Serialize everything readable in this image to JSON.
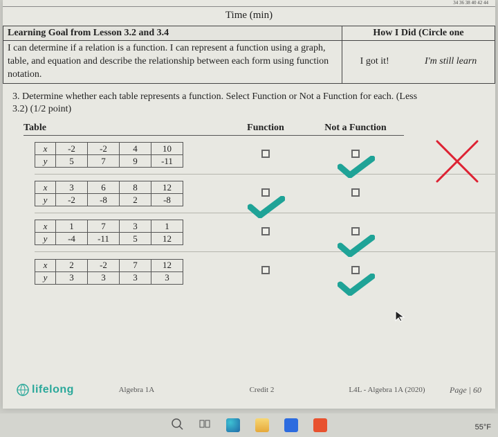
{
  "ruler_marks": "34   36   38   40   42   44",
  "time_label": "Time (min)",
  "goal": {
    "header": "Learning Goal from Lesson 3.2 and 3.4",
    "body": "I can determine if a relation is a function. I can represent a function using a graph, table, and equation and describe the relationship between each form using function notation.",
    "how_header": "How I Did (Circle one",
    "opt1": "I got it!",
    "opt2": "I'm still learn"
  },
  "question": "3.   Determine whether each table represents a function. Select Function or Not a Function for each. (Less\n       3.2) (1/2 point)",
  "cols": {
    "c1": "Table",
    "c2": "Function",
    "c3": "Not a Function"
  },
  "tables": [
    {
      "x": [
        "-2",
        "-2",
        "4",
        "10"
      ],
      "y": [
        "5",
        "7",
        "9",
        "-11"
      ]
    },
    {
      "x": [
        "3",
        "6",
        "8",
        "12"
      ],
      "y": [
        "-2",
        "-8",
        "2",
        "-8"
      ]
    },
    {
      "x": [
        "1",
        "7",
        "3",
        "1"
      ],
      "y": [
        "-4",
        "-11",
        "5",
        "12"
      ]
    },
    {
      "x": [
        "2",
        "-2",
        "7",
        "12"
      ],
      "y": [
        "3",
        "3",
        "3",
        "3"
      ]
    }
  ],
  "row_labels": {
    "x": "x",
    "y": "y"
  },
  "marks": {
    "row0": {
      "func": false,
      "notfunc": true
    },
    "row1": {
      "func": true,
      "notfunc": false
    },
    "row2": {
      "func": false,
      "notfunc": true
    },
    "row3": {
      "func": false,
      "notfunc": true
    }
  },
  "footer": {
    "brand": "lifelong",
    "course": "Algebra 1A",
    "credit": "Credit 2",
    "title": "L4L - Algebra 1A (2020)",
    "page": "Page | 60"
  },
  "temp": "55°F"
}
